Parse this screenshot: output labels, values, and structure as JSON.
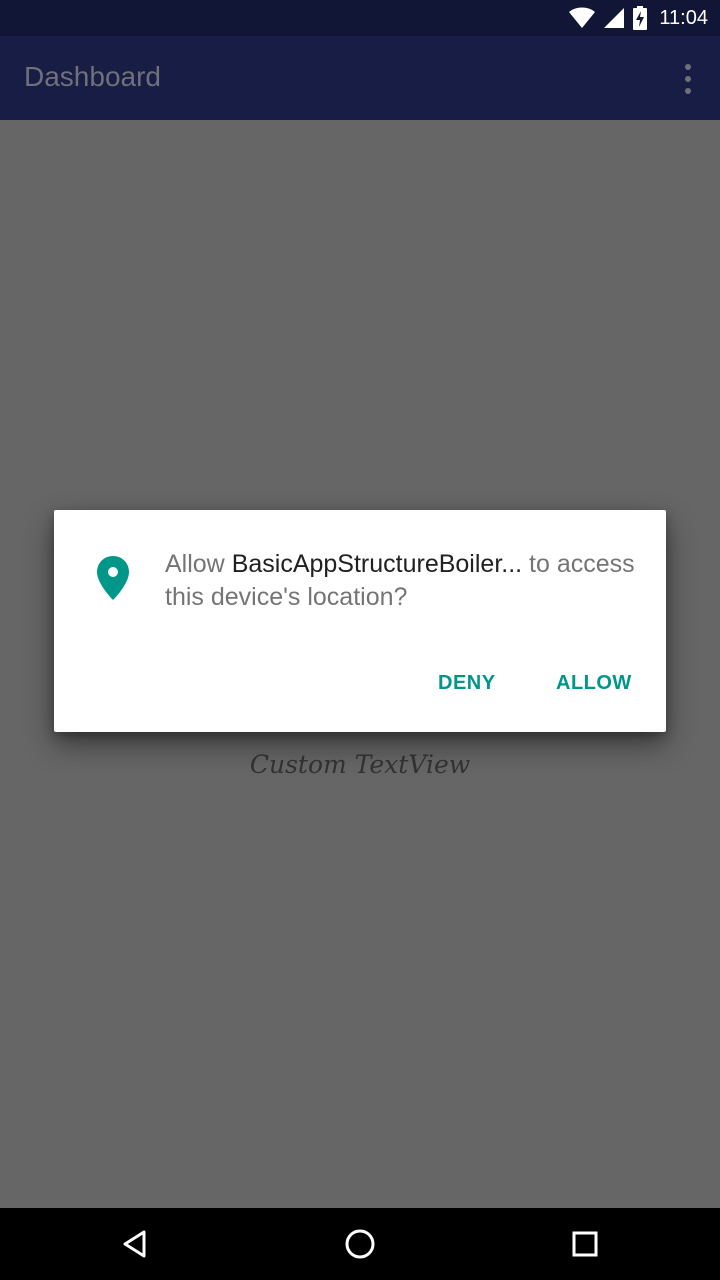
{
  "status_bar": {
    "time": "11:04",
    "icons": [
      "wifi-icon",
      "cellular-signal-icon",
      "battery-charging-icon"
    ]
  },
  "app_bar": {
    "title": "Dashboard",
    "menu_icon": "more-vert-icon"
  },
  "content": {
    "custom_text": "Custom TextView"
  },
  "permission_dialog": {
    "icon": "location-pin-icon",
    "icon_color": "#009688",
    "message_prefix": "Allow ",
    "app_name": "BasicAppStructureBoiler...",
    "message_suffix": " to access this device's location?",
    "deny_label": "DENY",
    "allow_label": "ALLOW"
  },
  "nav_bar": {
    "buttons": [
      "back-icon",
      "home-icon",
      "recents-icon"
    ]
  },
  "colors": {
    "status_bar": "#121636",
    "app_bar": "#181d46",
    "scrim_background": "#666666",
    "accent": "#009688"
  }
}
